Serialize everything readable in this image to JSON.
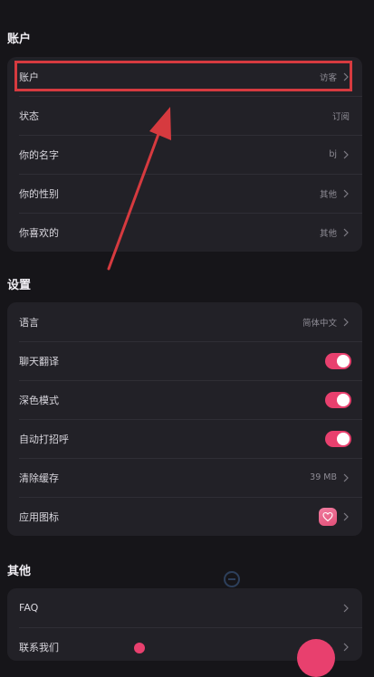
{
  "account_section": {
    "title": "账户",
    "rows": [
      {
        "label": "账户",
        "value": "访客"
      },
      {
        "label": "状态",
        "value": "订阅"
      },
      {
        "label": "你的名字",
        "value": "bj"
      },
      {
        "label": "你的性别",
        "value": "其他"
      },
      {
        "label": "你喜欢的",
        "value": "其他"
      }
    ]
  },
  "settings_section": {
    "title": "设置",
    "language": {
      "label": "语言",
      "value": "简体中文"
    },
    "chat_translate": {
      "label": "聊天翻译",
      "on": true
    },
    "dark_mode": {
      "label": "深色模式",
      "on": true
    },
    "auto_greeting": {
      "label": "自动打招呼",
      "on": true
    },
    "clear_cache": {
      "label": "清除缓存",
      "value": "39 MB"
    },
    "app_icon": {
      "label": "应用图标",
      "icon": "heart-icon"
    }
  },
  "other_section": {
    "title": "其他",
    "rows": [
      {
        "label": "FAQ"
      },
      {
        "label": "联系我们"
      }
    ]
  },
  "colors": {
    "background": "#161519",
    "card": "#222127",
    "accent": "#e8406e",
    "annotation_red": "#d63a3f"
  }
}
